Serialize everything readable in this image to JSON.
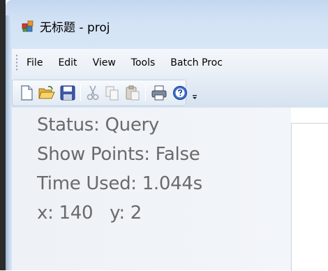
{
  "window": {
    "title": "无标题 - proj",
    "app_icon": "app-icon"
  },
  "menu": {
    "items": [
      {
        "label": "File"
      },
      {
        "label": "Edit"
      },
      {
        "label": "View"
      },
      {
        "label": "Tools"
      },
      {
        "label": "Batch Proc"
      }
    ]
  },
  "toolbar": {
    "buttons": [
      {
        "icon": "new-file-icon"
      },
      {
        "icon": "open-folder-icon"
      },
      {
        "icon": "save-icon"
      },
      {
        "icon": "cut-icon"
      },
      {
        "icon": "copy-icon"
      },
      {
        "icon": "paste-icon"
      },
      {
        "icon": "print-icon"
      },
      {
        "icon": "help-icon"
      },
      {
        "icon": "toolbar-overflow-icon"
      }
    ]
  },
  "status": {
    "status_line": "Status: Query",
    "points_line": "Show Points: False",
    "time_line": "Time Used: 1.044s",
    "coord_line": "x: 140   y: 2"
  },
  "colors": {
    "title_bar": "#d3e3f5",
    "status_text": "#6a6a6a",
    "panel_bg": "#eef2f7"
  }
}
